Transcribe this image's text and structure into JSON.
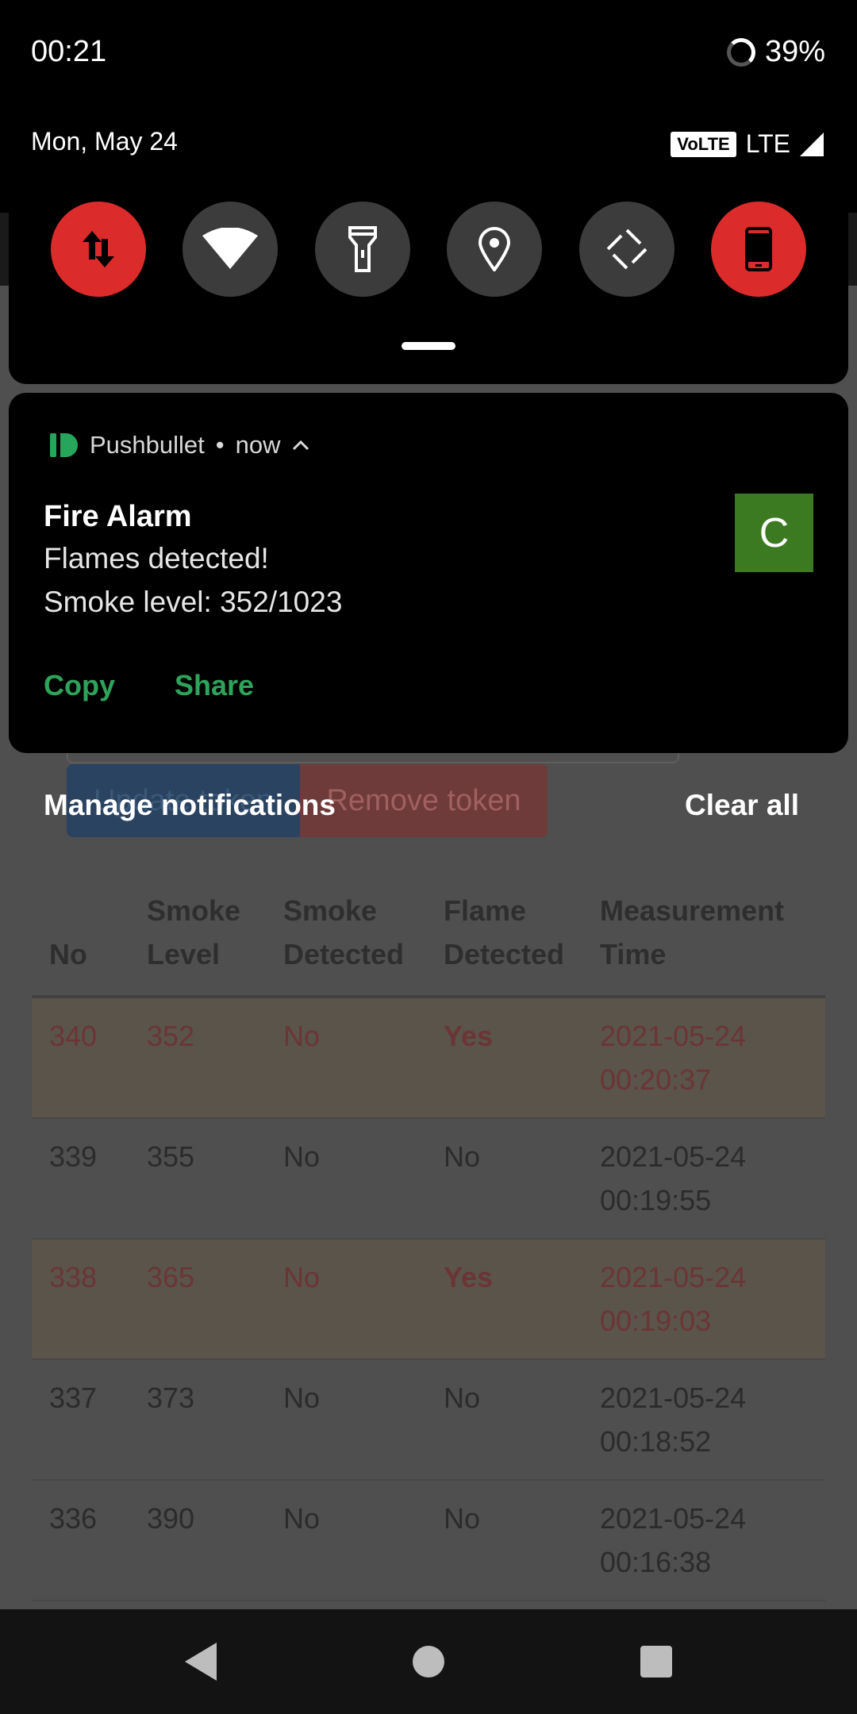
{
  "status_bar": {
    "time": "00:21",
    "battery": "39%"
  },
  "quick_settings": {
    "date": "Mon, May 24",
    "volte": "VoLTE",
    "network": "LTE",
    "tiles": [
      {
        "icon": "mobile-data-icon",
        "active": true
      },
      {
        "icon": "wifi-icon",
        "active": false
      },
      {
        "icon": "flashlight-icon",
        "active": false
      },
      {
        "icon": "location-icon",
        "active": false
      },
      {
        "icon": "auto-rotate-icon",
        "active": false
      },
      {
        "icon": "phone-icon",
        "active": true
      }
    ]
  },
  "notification": {
    "app": "Pushbullet",
    "separator": "•",
    "when": "now",
    "title": "Fire Alarm",
    "line1": "Flames detected!",
    "line2": "Smoke level: 352/1023",
    "avatar_letter": "C",
    "actions": [
      "Copy",
      "Share"
    ]
  },
  "shade_footer": {
    "manage": "Manage notifications",
    "clear_all": "Clear all"
  },
  "page": {
    "update_button": "Update token",
    "remove_button": "Remove token",
    "table": {
      "headers": [
        "No",
        "Smoke Level",
        "Smoke Detected",
        "Flame Detected",
        "Measurement Time"
      ],
      "rows": [
        {
          "no": "340",
          "smoke_level": "352",
          "smoke_detected": "No",
          "flame_detected": "Yes",
          "time": "2021-05-24 00:20:37",
          "alert": true
        },
        {
          "no": "339",
          "smoke_level": "355",
          "smoke_detected": "No",
          "flame_detected": "No",
          "time": "2021-05-24 00:19:55",
          "alert": false
        },
        {
          "no": "338",
          "smoke_level": "365",
          "smoke_detected": "No",
          "flame_detected": "Yes",
          "time": "2021-05-24 00:19:03",
          "alert": true
        },
        {
          "no": "337",
          "smoke_level": "373",
          "smoke_detected": "No",
          "flame_detected": "No",
          "time": "2021-05-24 00:18:52",
          "alert": false
        },
        {
          "no": "336",
          "smoke_level": "390",
          "smoke_detected": "No",
          "flame_detected": "No",
          "time": "2021-05-24 00:16:38",
          "alert": false
        }
      ]
    }
  },
  "colors": {
    "alert_red": "#dc2b2b",
    "pushbullet_green": "#26a65b",
    "avatar_green": "#3c7a21"
  }
}
